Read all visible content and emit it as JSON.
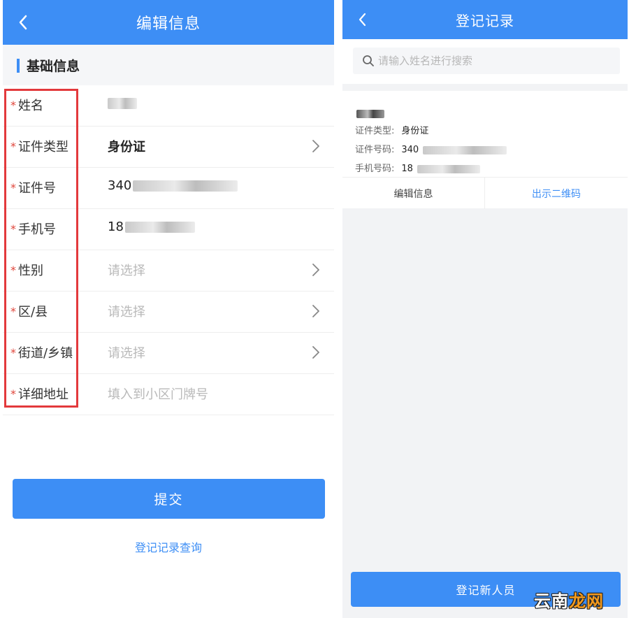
{
  "left": {
    "header": {
      "title": "编辑信息",
      "back_icon": "chevron-left-icon"
    },
    "section_title": "基础信息",
    "required_mark": "*",
    "fields": [
      {
        "label": "姓名",
        "value": "",
        "placeholder": "",
        "has_chevron": false
      },
      {
        "label": "证件类型",
        "value": "身份证",
        "placeholder": "",
        "has_chevron": true
      },
      {
        "label": "证件号",
        "value": "340",
        "placeholder": "",
        "has_chevron": false
      },
      {
        "label": "手机号",
        "value": "18",
        "placeholder": "",
        "has_chevron": false
      },
      {
        "label": "性别",
        "value": "",
        "placeholder": "请选择",
        "has_chevron": true
      },
      {
        "label": "区/县",
        "value": "",
        "placeholder": "请选择",
        "has_chevron": true
      },
      {
        "label": "街道/乡镇",
        "value": "",
        "placeholder": "请选择",
        "has_chevron": true
      },
      {
        "label": "详细地址",
        "value": "",
        "placeholder": "填入到小区门牌号",
        "has_chevron": false
      }
    ],
    "submit_label": "提交",
    "query_link": "登记记录查询"
  },
  "right": {
    "header": {
      "title": "登记记录",
      "back_icon": "chevron-left-icon"
    },
    "search": {
      "placeholder": "请输入姓名进行搜索",
      "icon": "search-icon"
    },
    "record": {
      "id_type_label": "证件类型:",
      "id_type_value": "身份证",
      "id_no_label": "证件号码:",
      "id_no_value": "340",
      "phone_label": "手机号码:",
      "phone_value": "18",
      "edit_label": "编辑信息",
      "qr_label": "出示二维码"
    },
    "register_label": "登记新人员"
  },
  "watermark": {
    "part1": "云南",
    "part2": "龙网"
  },
  "colors": {
    "primary": "#3d8ef5",
    "required": "#e0463b",
    "highlight": "#e3393c",
    "watermark_accent": "#f29a1f"
  }
}
